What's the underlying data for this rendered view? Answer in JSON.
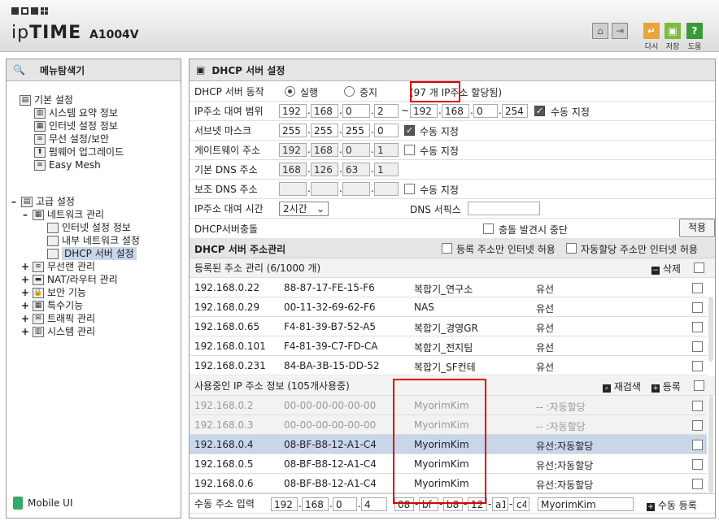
{
  "header": {
    "brand_ip": "ip",
    "brand_time": "TIME",
    "model": "A1004V",
    "buttons": [
      {
        "icon": "apply-icon",
        "label": "다시"
      },
      {
        "icon": "save-icon",
        "label": "저장"
      },
      {
        "icon": "help-icon",
        "label": "도움"
      }
    ],
    "nav_icons": [
      "home-icon",
      "logout-icon"
    ],
    "colors": {
      "apply": "#e8a33a",
      "save": "#7bbd3d",
      "help": "#3a9a3a"
    }
  },
  "menu": {
    "title": "메뉴탐색기",
    "basic": {
      "label": "기본 설정",
      "items": [
        "시스템 요약 정보",
        "인터넷 설정 정보",
        "무선 설정/보안",
        "펌웨어 업그레이드",
        "Easy Mesh"
      ]
    },
    "advanced": {
      "label": "고급 설정",
      "network": {
        "label": "네트워크 관리",
        "items": [
          "인터넷 설정 정보",
          "내부 네트워크 설정",
          "DHCP 서버 설정"
        ]
      },
      "items": [
        "무선랜 관리",
        "NAT/라우터 관리",
        "보안 기능",
        "특수기능",
        "트래픽 관리",
        "시스템 관리"
      ]
    },
    "mobile": "Mobile UI"
  },
  "panel": {
    "title": "DHCP 서버 설정",
    "dhcp_op": {
      "label": "DHCP 서버 동작",
      "run": "실행",
      "stop": "중지",
      "status": "(97 개 IP주소 할당됨)"
    },
    "range": {
      "label": "IP주소 대여 범위",
      "start": [
        "192",
        "168",
        "0",
        "2"
      ],
      "tilde": "~",
      "end": [
        "192",
        "168",
        "0",
        "254"
      ],
      "manual": "수동 지정"
    },
    "subnet": {
      "label": "서브넷 마스크",
      "value": [
        "255",
        "255",
        "255",
        "0"
      ],
      "manual": "수동 지정"
    },
    "gateway": {
      "label": "게이트웨이 주소",
      "value": [
        "192",
        "168",
        "0",
        "1"
      ],
      "manual": "수동 지정"
    },
    "dns1": {
      "label": "기본 DNS 주소",
      "value": [
        "168",
        "126",
        "63",
        "1"
      ]
    },
    "dns2": {
      "label": "보조 DNS 주소",
      "manual": "수동 지정"
    },
    "lease": {
      "label": "IP주소 대여 시간",
      "value": "2시간",
      "dns_suffix": "DNS 서픽스"
    },
    "conflict": {
      "label": "DHCP서버충돌",
      "option": "충돌 발견시 중단",
      "apply": "적용"
    },
    "addr_mgmt": {
      "title": "DHCP 서버 주소관리",
      "opt1": "등록 주소만 인터넷 허용",
      "opt2": "자동할당 주소만 인터넷 허용"
    },
    "registered": {
      "title": "등록된 주소 관리 (6/1000 개)",
      "delete": "삭제",
      "rows": [
        {
          "ip": "192.168.0.22",
          "mac": "88-87-17-FE-15-F6",
          "name": "복합기_연구소",
          "type": "유선"
        },
        {
          "ip": "192.168.0.29",
          "mac": "00-11-32-69-62-F6",
          "name": "NAS",
          "type": "유선"
        },
        {
          "ip": "192.168.0.65",
          "mac": "F4-81-39-B7-52-A5",
          "name": "복합기_경영GR",
          "type": "유선"
        },
        {
          "ip": "192.168.0.101",
          "mac": "F4-81-39-C7-FD-CA",
          "name": "복합기_전지팀",
          "type": "유선"
        },
        {
          "ip": "192.168.0.231",
          "mac": "84-BA-3B-15-DD-52",
          "name": "복합기_SF컨테",
          "type": "유선"
        }
      ]
    },
    "inuse": {
      "title": "사용중인 IP 주소 정보 (105개사용중)",
      "rescan": "재검색",
      "register": "등록",
      "rows": [
        {
          "ip": "192.168.0.2",
          "mac": "00-00-00-00-00-00",
          "name": "MyorimKim",
          "type": "-- :자동할당"
        },
        {
          "ip": "192.168.0.3",
          "mac": "00-00-00-00-00-00",
          "name": "MyorimKim",
          "type": "-- :자동할당"
        },
        {
          "ip": "192.168.0.4",
          "mac": "08-BF-B8-12-A1-C4",
          "name": "MyorimKim",
          "type": "유선:자동할당"
        },
        {
          "ip": "192.168.0.5",
          "mac": "08-BF-B8-12-A1-C4",
          "name": "MyorimKim",
          "type": "유선:자동할당"
        },
        {
          "ip": "192.168.0.6",
          "mac": "08-BF-B8-12-A1-C4",
          "name": "MyorimKim",
          "type": "유선:자동할당"
        }
      ]
    },
    "manual_input": {
      "label": "수동 주소 입력",
      "ip": [
        "192",
        "168",
        "0",
        "4"
      ],
      "mac": [
        "08",
        "bf",
        "b8",
        "12",
        "a1",
        "c4"
      ],
      "name": "MyorimKim",
      "button": "수동 등록"
    }
  }
}
